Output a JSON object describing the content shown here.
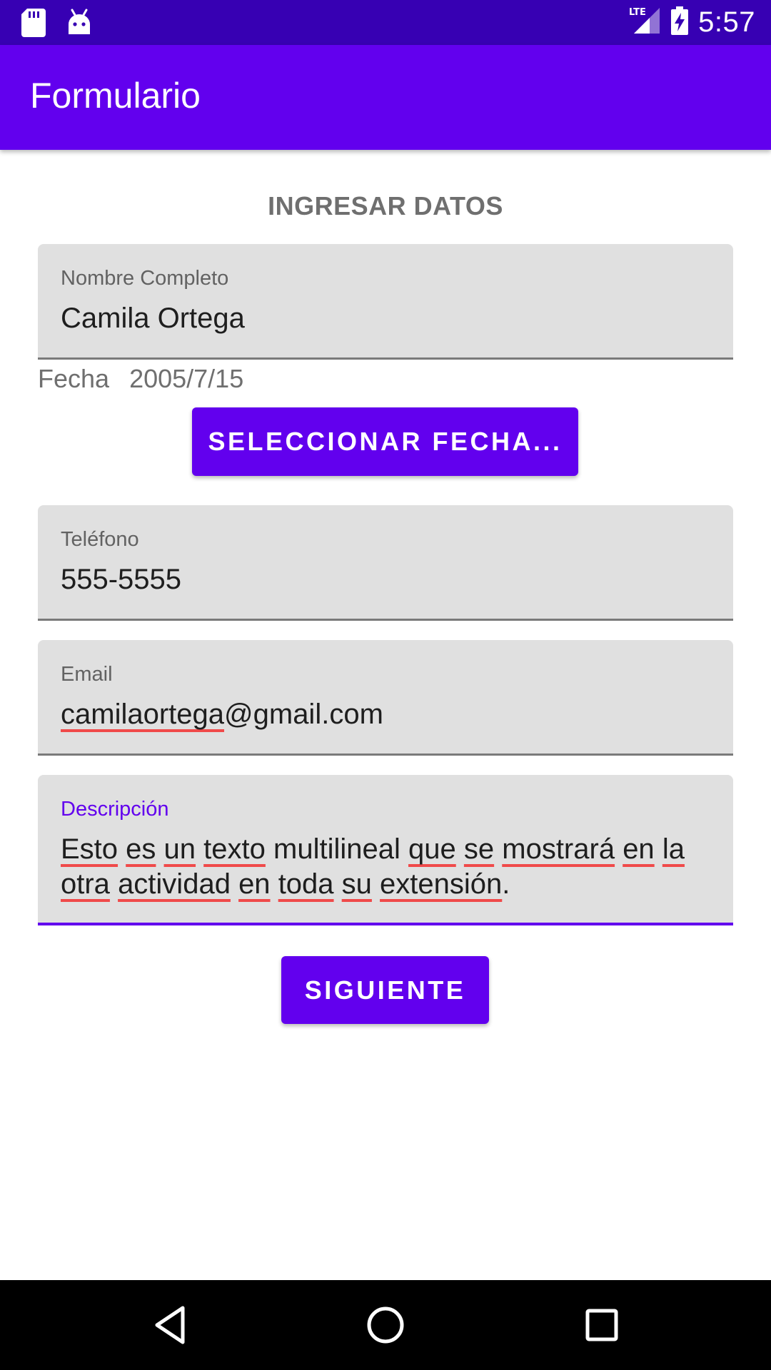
{
  "status_bar": {
    "time": "5:57",
    "network": "LTE",
    "left_icons": [
      "sd-card-icon",
      "android-debug-icon"
    ],
    "right_icons": [
      "lte-signal-icon",
      "battery-charging-icon"
    ]
  },
  "app_bar": {
    "title": "Formulario"
  },
  "form": {
    "heading": "INGRESAR DATOS",
    "name_field": {
      "label": "Nombre Completo",
      "value": "Camila Ortega"
    },
    "date": {
      "label": "Fecha",
      "value": "2005/7/15"
    },
    "select_date_button": "SELECCIONAR FECHA...",
    "phone_field": {
      "label": "Teléfono",
      "value": "555-5555"
    },
    "email_field": {
      "label": "Email",
      "value": "camilaortega@gmail.com",
      "local_part": "camilaortega",
      "domain_part": "@gmail.com"
    },
    "description_field": {
      "label": "Descripción",
      "value": "Esto es un texto multilineal que se mostrará en la otra actividad en toda su extensión.",
      "words": [
        "Esto",
        "es",
        "un",
        "texto",
        "multilineal",
        "que",
        "se",
        "mostrará",
        "en",
        "la",
        "otra",
        "actividad",
        "en",
        "toda",
        "su",
        "extensión",
        "."
      ]
    },
    "next_button": "SIGUIENTE"
  },
  "nav_bar": {
    "icons": [
      "back-icon",
      "home-icon",
      "recents-icon"
    ]
  },
  "colors": {
    "primary": "#6200ee",
    "primary_dark": "#3700b3",
    "field_bg": "#e0e0e0",
    "spell_error": "#f04a4a"
  }
}
